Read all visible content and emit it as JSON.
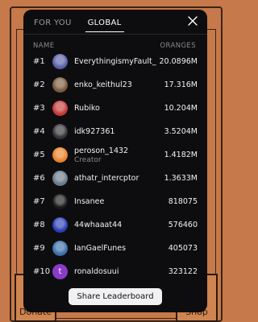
{
  "background": {
    "left_button": "Donate",
    "right_button": "Shop"
  },
  "tabs": [
    {
      "label": "FOR YOU",
      "active": false
    },
    {
      "label": "GLOBAL",
      "active": true
    }
  ],
  "close_icon": "close-icon",
  "headers": {
    "name": "NAME",
    "score": "ORANGES"
  },
  "rows": [
    {
      "rank": "#1",
      "name": "EverythingismyFault_",
      "score": "20.0896M",
      "avatar_color": "#5b5fa8"
    },
    {
      "rank": "#2",
      "name": "enko_keithul23",
      "score": "17.316M",
      "avatar_color": "#7a5a3e"
    },
    {
      "rank": "#3",
      "name": "Rubiko",
      "score": "10.204M",
      "avatar_color": "#c43a3a"
    },
    {
      "rank": "#4",
      "name": "idk927361",
      "score": "3.5204M",
      "avatar_color": "#333338"
    },
    {
      "rank": "#5",
      "name": "peroson_1432",
      "subtitle": "Creator",
      "score": "1.4182M",
      "avatar_color": "#e8822a"
    },
    {
      "rank": "#6",
      "name": "athatr_intercptor",
      "score": "1.3633M",
      "avatar_color": "#6a7a88"
    },
    {
      "rank": "#7",
      "name": "Insanee",
      "score": "818075",
      "avatar_color": "#1a1a1a"
    },
    {
      "rank": "#8",
      "name": "44whaaat44",
      "score": "576460",
      "avatar_color": "#2b3fb5"
    },
    {
      "rank": "#9",
      "name": "IanGaelFunes",
      "score": "405073",
      "avatar_color": "#3d6ea8"
    },
    {
      "rank": "#10",
      "name": "ronaldosuui",
      "score": "323122",
      "avatar_color": "#8a3cc8",
      "avatar_letter": "t"
    }
  ],
  "share_button": "Share Leaderboard"
}
